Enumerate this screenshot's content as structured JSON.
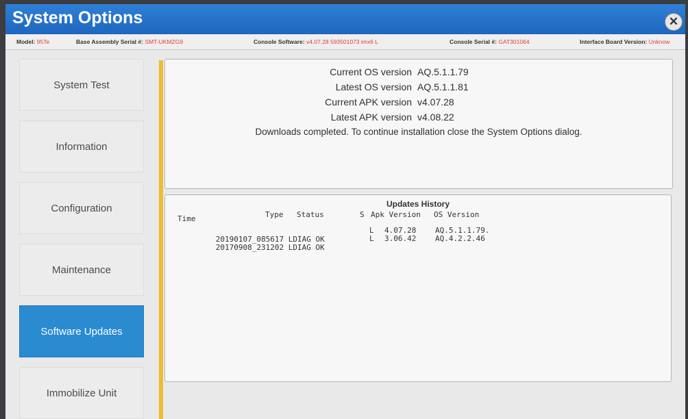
{
  "window": {
    "title": "System Options",
    "close_icon": "close-icon"
  },
  "info": {
    "model_label": "Model:",
    "model_value": "95Te",
    "base_serial_label": "Base Assembly Serial #:",
    "base_serial_value": "SMT-UKMZG9",
    "console_sw_label": "Console Software:",
    "console_sw_value": "v4.07.28 593501073 imx6 L",
    "console_serial_label": "Console Serial #:",
    "console_serial_value": "GAT301064",
    "interface_label": "Interface Board Version:",
    "interface_value": "Unknow"
  },
  "sidebar": {
    "items": [
      {
        "label": "System Test"
      },
      {
        "label": "Information"
      },
      {
        "label": "Configuration"
      },
      {
        "label": "Maintenance"
      },
      {
        "label": "Software Updates"
      },
      {
        "label": "Immobilize Unit"
      }
    ]
  },
  "versions": {
    "current_os_label": "Current OS version",
    "current_os_value": "AQ.5.1.1.79",
    "latest_os_label": "Latest OS version",
    "latest_os_value": "AQ.5.1.1.81",
    "current_apk_label": "Current APK version",
    "current_apk_value": "v4.07.28",
    "latest_apk_label": "Latest APK version",
    "latest_apk_value": "v4.08.22",
    "message": "Downloads completed. To continue installation close the System Options dialog."
  },
  "history": {
    "title": "Updates History",
    "headers": {
      "time": "Time",
      "type": "Type",
      "status": "Status",
      "s": "S",
      "apk": "Apk Version",
      "os": "OS Version"
    },
    "rows": [
      {
        "time": "20190107_085617",
        "type": "LDIAG",
        "status": "OK",
        "s": "L",
        "apk": "4.07.28",
        "os": "AQ.5.1.1.79."
      },
      {
        "time": "20170908_231202",
        "type": "LDIAG",
        "status": "OK",
        "s": "L",
        "apk": "3.06.42",
        "os": "AQ.4.2.2.46"
      }
    ]
  },
  "colors": {
    "title_bar": "#1f66bf",
    "active_tab": "#2a8bd1",
    "accent": "#ecbe2f",
    "info_value": "#e03c3c"
  }
}
